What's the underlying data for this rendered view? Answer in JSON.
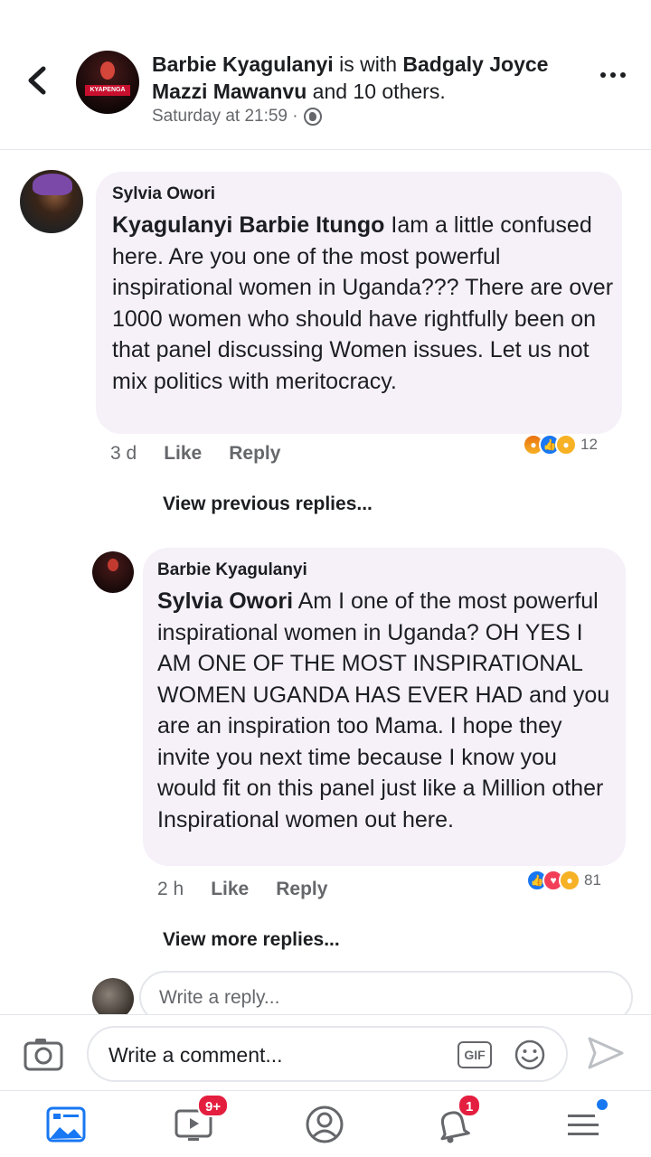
{
  "post": {
    "author": "Barbie Kyagulanyi",
    "with_connector": " is with ",
    "tagged": "Badgaly Joyce Mazzi Mawanvu",
    "and_others": " and 10 others.",
    "time": "Saturday at 21:59 ·",
    "avatar_caption": "KYAPENGA"
  },
  "comments": [
    {
      "author": "Sylvia Owori",
      "mention": "Kyagulanyi Barbie Itungo",
      "text": " Iam a little confused here. Are you one of the most powerful inspirational women in Uganda??? There are over 1000 women who should have rightfully been on that panel discussing Women issues. Let us not mix politics with meritocracy.",
      "age": "3 d",
      "like_label": "Like",
      "reply_label": "Reply",
      "reaction_count": "12",
      "reactions": [
        "angry",
        "like",
        "haha"
      ]
    },
    {
      "author": "Barbie Kyagulanyi",
      "mention": "Sylvia Owori",
      "text": " Am I one of the most powerful inspirational women in Uganda? OH YES I AM ONE OF THE MOST INSPIRATIONAL WOMEN UGANDA HAS EVER HAD and you are an inspiration too Mama. I hope they invite you next time because I know you would fit on this panel just like a Million other Inspirational women out here.",
      "age": "2 h",
      "like_label": "Like",
      "reply_label": "Reply",
      "reaction_count": "81",
      "reactions": [
        "like",
        "love",
        "haha"
      ]
    }
  ],
  "view_previous": "View previous replies...",
  "view_more": "View more replies...",
  "reply_placeholder": "Write a reply...",
  "composer": {
    "placeholder": "Write a comment...",
    "gif_label": "GIF"
  },
  "nav": {
    "watch_badge": "9+",
    "notifications_badge": "1"
  },
  "colors": {
    "accent": "#1877f2",
    "badge": "#e41e3f",
    "bubble": "#f6f1f8"
  }
}
